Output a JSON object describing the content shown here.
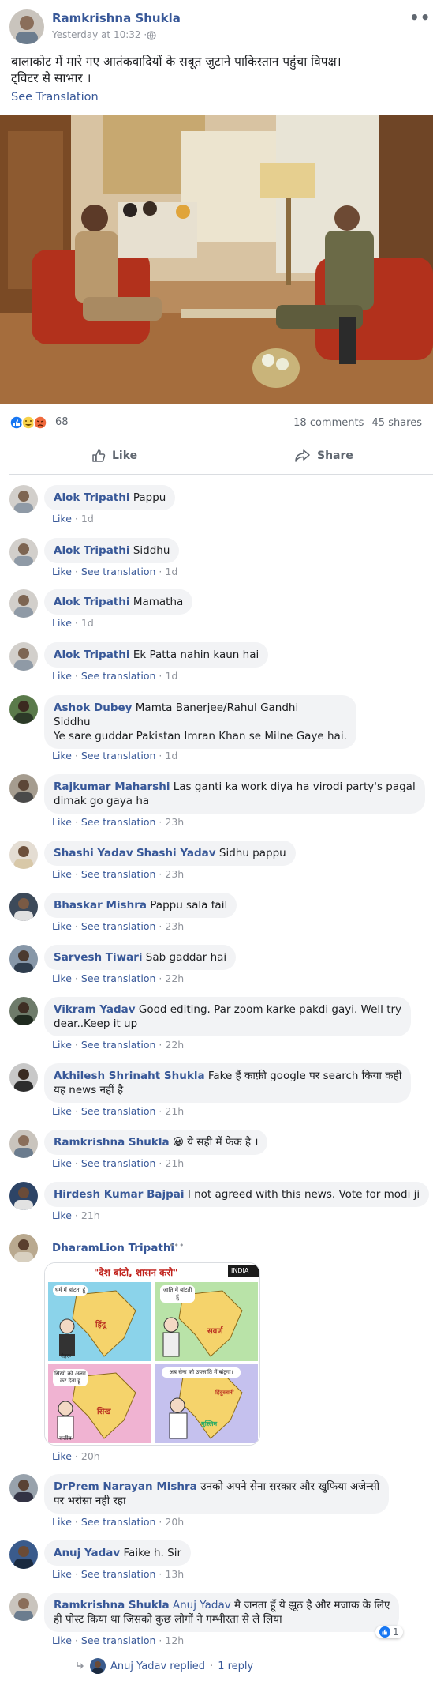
{
  "post": {
    "author": "Ramkrishna Shukla",
    "time": "Yesterday at 10:32 ·",
    "text_line1": "बालाकोट में मारे गए आतंकवादियों के सबूत जुटाने पाकिस्तान पहुंचा विपक्ष।",
    "text_line2": "ट्विटर से साभार ।",
    "see_translation": "See Translation",
    "more": "•••",
    "reaction_count": "68",
    "comments": "18 comments",
    "shares": "45 shares",
    "like_label": "Like",
    "share_label": "Share"
  },
  "comments": [
    {
      "name": "Alok Tripathi",
      "text": "Pappu",
      "like": "Like",
      "translate": "",
      "time": "1d"
    },
    {
      "name": "Alok Tripathi",
      "text": "Siddhu",
      "like": "Like",
      "translate": "See translation",
      "time": "1d"
    },
    {
      "name": "Alok Tripathi",
      "text": "Mamatha",
      "like": "Like",
      "translate": "",
      "time": "1d"
    },
    {
      "name": "Alok Tripathi",
      "text": "Ek Patta nahin kaun hai",
      "like": "Like",
      "translate": "See translation",
      "time": "1d"
    },
    {
      "name": "Ashok Dubey",
      "text_l1": "Mamta Banerjee/Rahul Gandhi",
      "text_l2": "Siddhu",
      "text_l3": "Ye sare guddar Pakistan Imran Khan se Milne Gaye hai.",
      "like": "Like",
      "translate": "See translation",
      "time": "1d"
    },
    {
      "name": "Rajkumar Maharshi",
      "text_l1": "Las ganti ka work diya ha virodi party's pagal",
      "text_l2": "dimak go gaya ha",
      "like": "Like",
      "translate": "See translation",
      "time": "23h"
    },
    {
      "name": "Shashi Yadav",
      "tag": "Shashi Yadav",
      "text": "Sidhu pappu",
      "like": "Like",
      "translate": "See translation",
      "time": "23h"
    },
    {
      "name": "Bhaskar Mishra",
      "text": "Pappu sala fail",
      "like": "Like",
      "translate": "See translation",
      "time": "23h"
    },
    {
      "name": "Sarvesh Tiwari",
      "text": "Sab gaddar hai",
      "like": "Like",
      "translate": "See translation",
      "time": "22h"
    },
    {
      "name": "Vikram Yadav",
      "text_l1": "Good editing. Par zoom karke pakdi gayi. Well try",
      "text_l2": "dear..Keep it up",
      "like": "Like",
      "translate": "See translation",
      "time": "22h"
    },
    {
      "name": "Akhilesh Shrinaht Shukla",
      "text_l1": "Fake हैं काफ़ी google पर search किया कही",
      "text_l2": "यह news नहीं है",
      "like": "Like",
      "translate": "See translation",
      "time": "21h"
    },
    {
      "name": "Ramkrishna Shukla",
      "emoji": "😀",
      "text": "ये सही में फेक है ।",
      "like": "Like",
      "translate": "See translation",
      "time": "21h"
    },
    {
      "name": "Hirdesh Kumar Bajpai",
      "text": "I not agreed with this news. Vote for modi ji",
      "like": "Like",
      "translate": "",
      "time": "21h"
    },
    {
      "name": "DharamLion Tripathi",
      "dots": "•••",
      "like": "Like",
      "translate": "",
      "time": "20h"
    },
    {
      "name": "DrPrem Narayan Mishra",
      "text_l1": "उनको अपने सेना सरकार और खुफिया अजेन्सी",
      "text_l2": "पर भरोसा नही रहा",
      "like": "Like",
      "translate": "See translation",
      "time": "20h"
    },
    {
      "name": "Anuj Yadav",
      "text": "Faike h. Sir",
      "like": "Like",
      "translate": "See translation",
      "time": "13h"
    },
    {
      "name": "Ramkrishna Shukla",
      "tag": "Anuj Yadav",
      "text_l1": "मै जनता हूँ ये झूठ है और मजाक के लिए",
      "text_l2": "ही पोस्ट किया था जिसको कुछ लोगों ने गम्भीरता से ले लिया",
      "like": "Like",
      "translate": "See translation",
      "time": "12h",
      "reactions": "1"
    }
  ],
  "replies": {
    "text": "Anuj Yadav replied",
    "count": "1 reply",
    "dot": "·"
  },
  "cartoon": {
    "title": "\"देश बांटो, शासन करो\"",
    "panel1_caption": "धर्म में बांटता हूं",
    "panel1_label": "हिंदू",
    "panel1_name": "नेहरू",
    "panel2_caption": "जाति में बांटती हूं",
    "panel2_label": "सवर्ण",
    "panel3_caption": "सिखों को अलग कर देता हूं",
    "panel3_label": "सिख",
    "panel3_name": "राजीव",
    "panel4_caption": "अब सेना को उपजाति में बांटूगा।",
    "panel4_label": "मुस्लिम",
    "panel4_label2": "हिंदुस्तानी",
    "badge": "INDIA"
  },
  "colors": {
    "link": "#385898",
    "meta": "#90949c",
    "bubble": "#f2f3f5",
    "like_blue": "#1877f2"
  }
}
